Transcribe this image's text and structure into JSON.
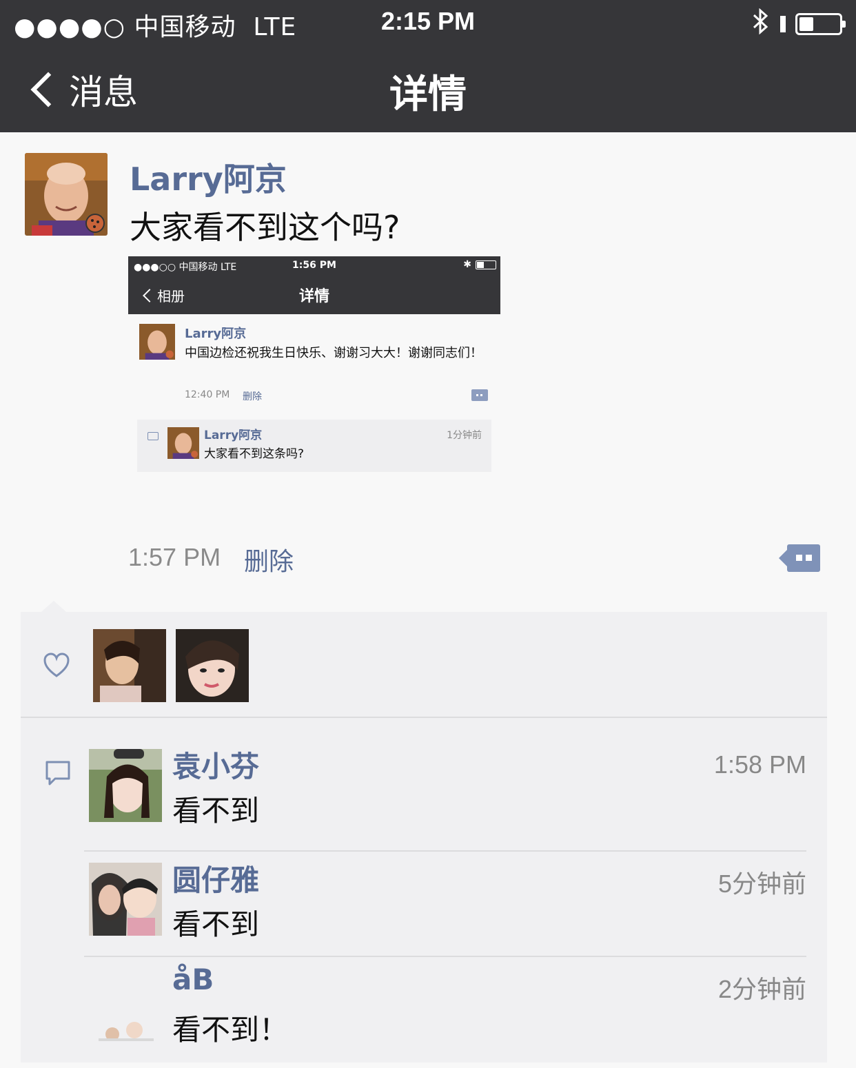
{
  "status_bar": {
    "carrier": "●●●●○ 中国移动",
    "network": "LTE",
    "time": "2:15 PM",
    "battery_level": 0.35
  },
  "nav": {
    "back_label": "消息",
    "title": "详情"
  },
  "post": {
    "author": "Larry阿京",
    "text": "大家看不到这个吗?",
    "time": "1:57 PM",
    "delete_label": "删除",
    "screenshot": {
      "status_left": "●●●○○ 中国移动   LTE",
      "status_time": "1:56 PM",
      "back_label": "相册",
      "title": "详情",
      "author": "Larry阿京",
      "text": "中国边检还祝我生日快乐、谢谢习大大！谢谢同志们！",
      "time": "12:40 PM",
      "delete_label": "删除",
      "comment": {
        "name": "Larry阿京",
        "text": "大家看不到这条吗?",
        "time": "1分钟前"
      }
    }
  },
  "likes": {
    "count": 2
  },
  "comments": [
    {
      "name": "袁小芬",
      "text": "看不到",
      "time": "1:58 PM"
    },
    {
      "name": "圆仔雅",
      "text": "看不到",
      "time": "5分钟前"
    },
    {
      "name": "åB",
      "text": "看不到！",
      "time": "2分钟前"
    }
  ],
  "colors": {
    "bar": "#363639",
    "link": "#576b95",
    "panel": "#f0f0f2"
  }
}
